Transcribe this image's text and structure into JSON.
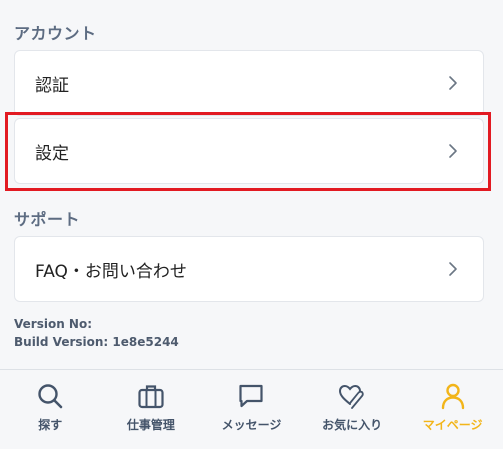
{
  "account": {
    "title": "アカウント",
    "items": [
      {
        "label": "認証"
      },
      {
        "label": "設定"
      }
    ]
  },
  "support": {
    "title": "サポート",
    "items": [
      {
        "label": "FAQ・お問い合わせ"
      }
    ]
  },
  "version": {
    "version_no": "Version No:",
    "build_version": "Build Version: 1e8e5244"
  },
  "tabbar": {
    "tabs": [
      {
        "label": "探す",
        "icon": "search-icon"
      },
      {
        "label": "仕事管理",
        "icon": "briefcase-icon"
      },
      {
        "label": "メッセージ",
        "icon": "chat-icon"
      },
      {
        "label": "お気に入り",
        "icon": "heart-clip-icon"
      },
      {
        "label": "マイページ",
        "icon": "person-icon",
        "active": true
      }
    ]
  },
  "colors": {
    "accent": "#f2b51a",
    "highlight": "#e21a22",
    "section_title": "#5d6c82",
    "tab_label": "#44546a"
  }
}
